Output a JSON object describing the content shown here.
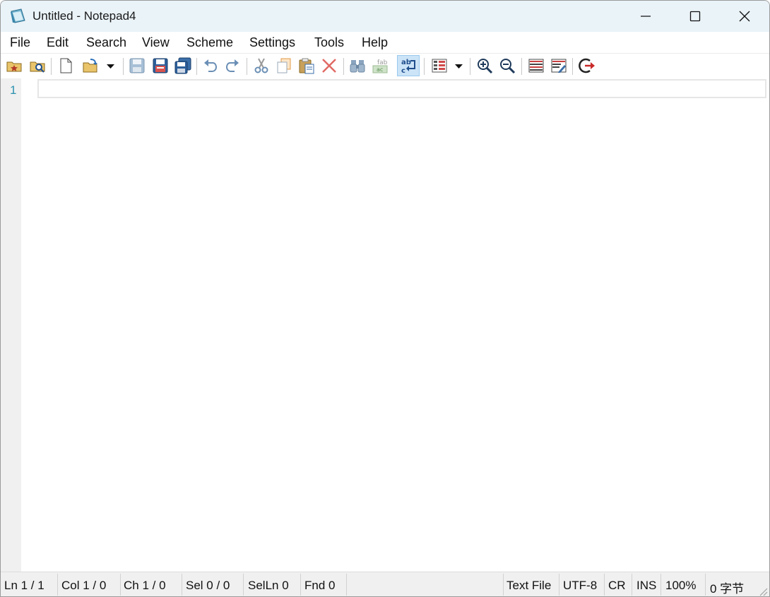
{
  "window": {
    "title": "Untitled - Notepad4"
  },
  "menu": [
    "File",
    "Edit",
    "Search",
    "View",
    "Scheme",
    "Settings",
    "Tools",
    "Help"
  ],
  "toolbar_icons": [
    "favorites-open-icon",
    "browse-icon",
    "new-file-icon",
    "open-file-icon",
    "dropdown-arrow-icon",
    "save-icon",
    "save-as-icon",
    "save-copy-icon",
    "undo-icon",
    "redo-icon",
    "cut-icon",
    "copy-icon",
    "paste-icon",
    "delete-icon",
    "find-icon",
    "replace-icon",
    "word-wrap-icon",
    "scheme-icon",
    "dropdown-arrow-icon",
    "zoom-in-icon",
    "zoom-out-icon",
    "settings-icon",
    "edit-settings-icon",
    "exit-icon"
  ],
  "editor": {
    "line_numbers": [
      "1"
    ],
    "content": ""
  },
  "status": {
    "ln": "Ln 1 / 1",
    "col": "Col 1 / 0",
    "ch": "Ch 1 / 0",
    "sel": "Sel 0 / 0",
    "selln": "SelLn 0",
    "fnd": "Fnd 0",
    "filetype": "Text File",
    "encoding": "UTF-8",
    "eol": "CR",
    "insert_mode": "INS",
    "zoom": "100%",
    "size": "0 字节"
  },
  "colors": {
    "titlebar": "#eaf3f8",
    "line_number": "#2b91af",
    "gutter": "#f0f0f0",
    "active_button": "#cce4f7"
  }
}
